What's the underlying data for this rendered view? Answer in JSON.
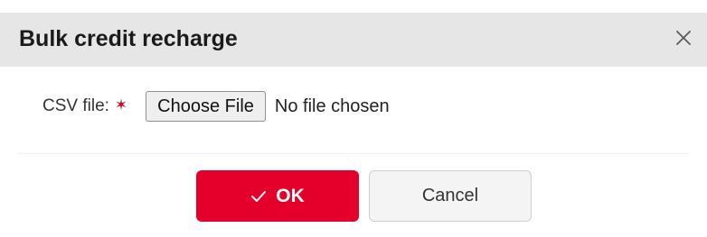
{
  "dialog": {
    "title": "Bulk credit recharge",
    "close_icon": "close-icon"
  },
  "form": {
    "csv_label": "CSV file:",
    "required_marker": "✶",
    "file_button_label": "Choose File",
    "file_status": "No file chosen"
  },
  "actions": {
    "ok_label": "OK",
    "ok_icon": "checkmark-icon",
    "cancel_label": "Cancel"
  },
  "colors": {
    "primary": "#e4002b",
    "header_bg": "#e6e6e6",
    "required": "#d0021b"
  }
}
